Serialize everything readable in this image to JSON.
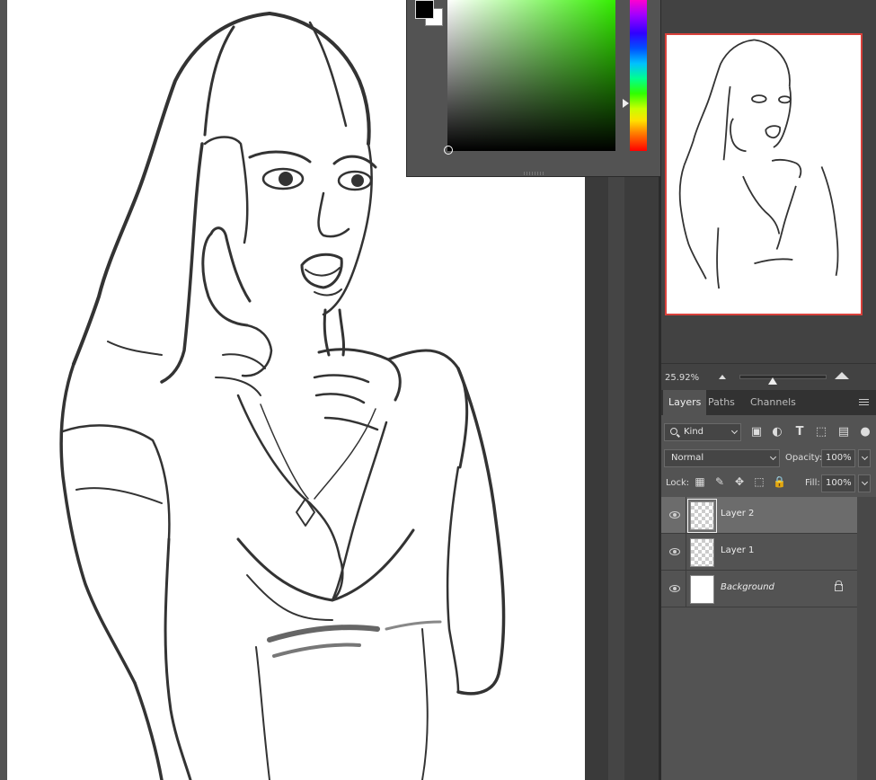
{
  "canvas": {
    "document_background": "#ffffff"
  },
  "color_picker": {
    "foreground": "#000000",
    "background": "#ffffff",
    "hue": "#33ee00"
  },
  "navigator": {
    "zoom": "25.92%",
    "frame_color": "#d9413b"
  },
  "panel_tabs": [
    {
      "label": "Layers",
      "active": true
    },
    {
      "label": "Paths",
      "active": false
    },
    {
      "label": "Channels",
      "active": false
    }
  ],
  "layers_panel": {
    "filter_kind": "Kind",
    "blend_mode": "Normal",
    "opacity_label": "Opacity:",
    "opacity": "100%",
    "lock_label": "Lock:",
    "fill_label": "Fill:",
    "fill": "100%",
    "layers": [
      {
        "name": "Layer 2",
        "selected": true,
        "visible": true
      },
      {
        "name": "Layer 1",
        "selected": false,
        "visible": true
      },
      {
        "name": "Background",
        "selected": false,
        "visible": true,
        "locked": true
      }
    ]
  },
  "icons": [
    "search-icon",
    "image-filter-icon",
    "adjustment-filter-icon",
    "type-filter-icon",
    "shape-filter-icon",
    "smart-object-filter-icon",
    "filter-toggle-icon",
    "lock-transparent-icon",
    "lock-paint-icon",
    "lock-move-icon",
    "lock-artboard-icon",
    "lock-all-icon",
    "eye-icon",
    "panel-menu-icon",
    "zoom-out-icon",
    "zoom-in-icon"
  ]
}
